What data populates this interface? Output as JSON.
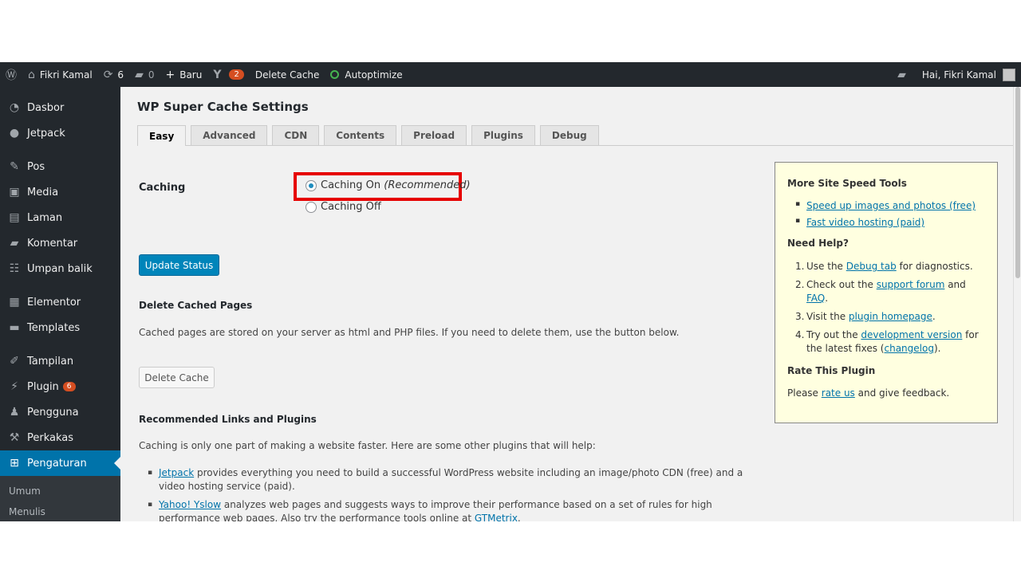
{
  "adminbar": {
    "site_name": "Fikri Kamal",
    "updates_count": "6",
    "comments_count": "0",
    "new_label": "Baru",
    "yoast_count": "2",
    "delete_cache_label": "Delete Cache",
    "autoptimize_label": "Autoptimize",
    "greeting": "Hai, Fikri Kamal"
  },
  "sidebar": {
    "items": [
      {
        "label": "Dasbor"
      },
      {
        "label": "Jetpack"
      },
      {
        "label": "Pos"
      },
      {
        "label": "Media"
      },
      {
        "label": "Laman"
      },
      {
        "label": "Komentar"
      },
      {
        "label": "Umpan balik"
      },
      {
        "label": "Elementor"
      },
      {
        "label": "Templates"
      },
      {
        "label": "Tampilan"
      },
      {
        "label": "Plugin",
        "badge": "6"
      },
      {
        "label": "Pengguna"
      },
      {
        "label": "Perkakas"
      },
      {
        "label": "Pengaturan"
      }
    ],
    "submenu": [
      "Umum",
      "Menulis"
    ]
  },
  "main": {
    "title": "WP Super Cache Settings",
    "tabs": [
      "Easy",
      "Advanced",
      "CDN",
      "Contents",
      "Preload",
      "Plugins",
      "Debug"
    ],
    "caching_label": "Caching",
    "caching_on": "Caching On",
    "caching_on_note": "(Recommended)",
    "caching_off": "Caching Off",
    "update_button": "Update Status",
    "delete_heading": "Delete Cached Pages",
    "delete_text": "Cached pages are stored on your server as html and PHP files. If you need to delete them, use the button below.",
    "delete_button": "Delete Cache",
    "rec_heading": "Recommended Links and Plugins",
    "rec_text": "Caching is only one part of making a website faster. Here are some other plugins that will help:",
    "rec_items": [
      {
        "link": "Jetpack",
        "text": " provides everything you need to build a successful WordPress website including an image/photo CDN (free) and a video hosting service (paid)."
      },
      {
        "link": "Yahoo! Yslow",
        "text": " analyzes web pages and suggests ways to improve their performance based on a set of rules for high performance web pages. Also try the performance tools online at ",
        "link2": "GTMetrix",
        "tail": "."
      }
    ]
  },
  "sidebox": {
    "speed_heading": "More Site Speed Tools",
    "speed_links": [
      "Speed up images and photos (free)",
      "Fast video hosting (paid)"
    ],
    "help_heading": "Need Help?",
    "help": {
      "s1_pre": "Use the ",
      "s1_link": "Debug tab",
      "s1_post": " for diagnostics.",
      "s2_pre": "Check out the ",
      "s2_link": "support forum",
      "s2_mid": " and ",
      "s2_link2": "FAQ",
      "s2_post": ".",
      "s3_pre": "Visit the ",
      "s3_link": "plugin homepage",
      "s3_post": ".",
      "s4_pre": "Try out the ",
      "s4_link": "development version",
      "s4_mid": " for the latest fixes (",
      "s4_link2": "changelog",
      "s4_post": ")."
    },
    "rate_heading": "Rate This Plugin",
    "rate_pre": "Please ",
    "rate_link": "rate us",
    "rate_post": " and give feedback."
  }
}
